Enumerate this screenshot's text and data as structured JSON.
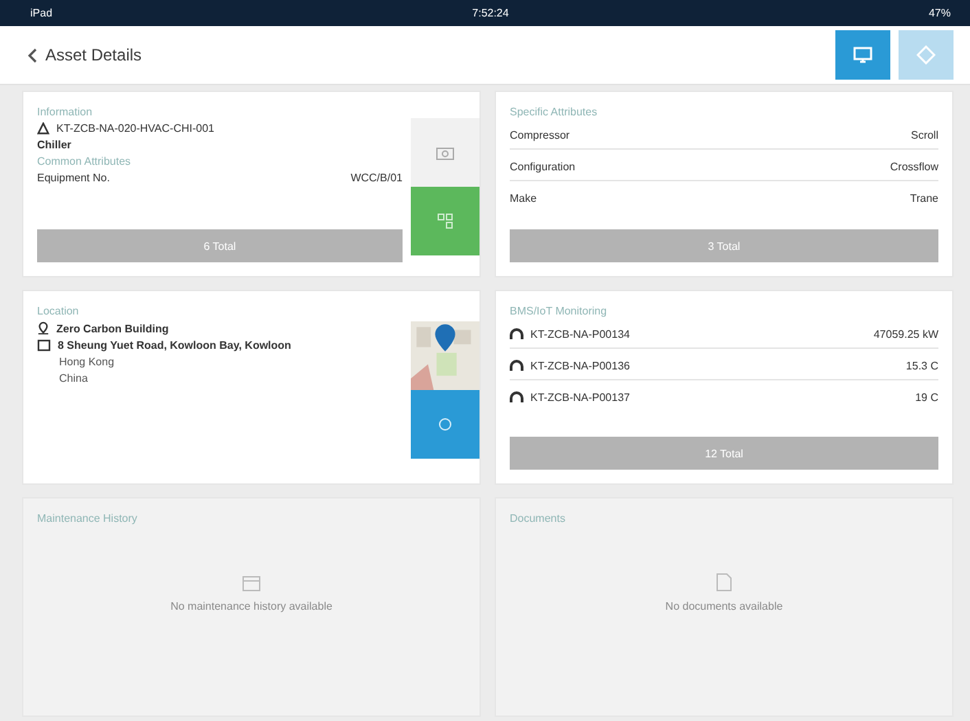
{
  "status_bar": {
    "carrier": "iPad",
    "time": "7:52:24",
    "battery": "47%"
  },
  "header": {
    "back_label": "Asset Details",
    "buttons": [
      {
        "kind": "screen",
        "selected": true
      },
      {
        "kind": "diamond",
        "selected": false
      }
    ]
  },
  "information": {
    "title": "Information",
    "asset_id": "KT-ZCB-NA-020-HVAC-CHI-001",
    "asset_type": "Chiller",
    "common_title": "Common Attributes",
    "attributes": [
      {
        "label": "Equipment No.",
        "value": "WCC/B/01"
      }
    ],
    "total": "6 Total"
  },
  "specific": {
    "title": "Specific Attributes",
    "rows": [
      {
        "label": "Compressor",
        "value": "Scroll"
      },
      {
        "label": "Configuration",
        "value": "Crossflow"
      },
      {
        "label": "Make",
        "value": "Trane"
      }
    ],
    "total": "3 Total"
  },
  "location": {
    "title": "Location",
    "building": "Zero Carbon Building",
    "address": "8 Sheung Yuet Road, Kowloon Bay, Kowloon",
    "city": "Hong Kong",
    "country": "China"
  },
  "monitoring": {
    "title": "BMS/IoT Monitoring",
    "rows": [
      {
        "id": "KT-ZCB-NA-P00134",
        "value": "47059.25 kW"
      },
      {
        "id": "KT-ZCB-NA-P00136",
        "value": "15.3 C"
      },
      {
        "id": "KT-ZCB-NA-P00137",
        "value": "19 C"
      }
    ],
    "total": "12 Total"
  },
  "maintenance": {
    "title": "Maintenance History",
    "empty": "No maintenance history available"
  },
  "documents": {
    "title": "Documents",
    "empty": "No documents available"
  }
}
